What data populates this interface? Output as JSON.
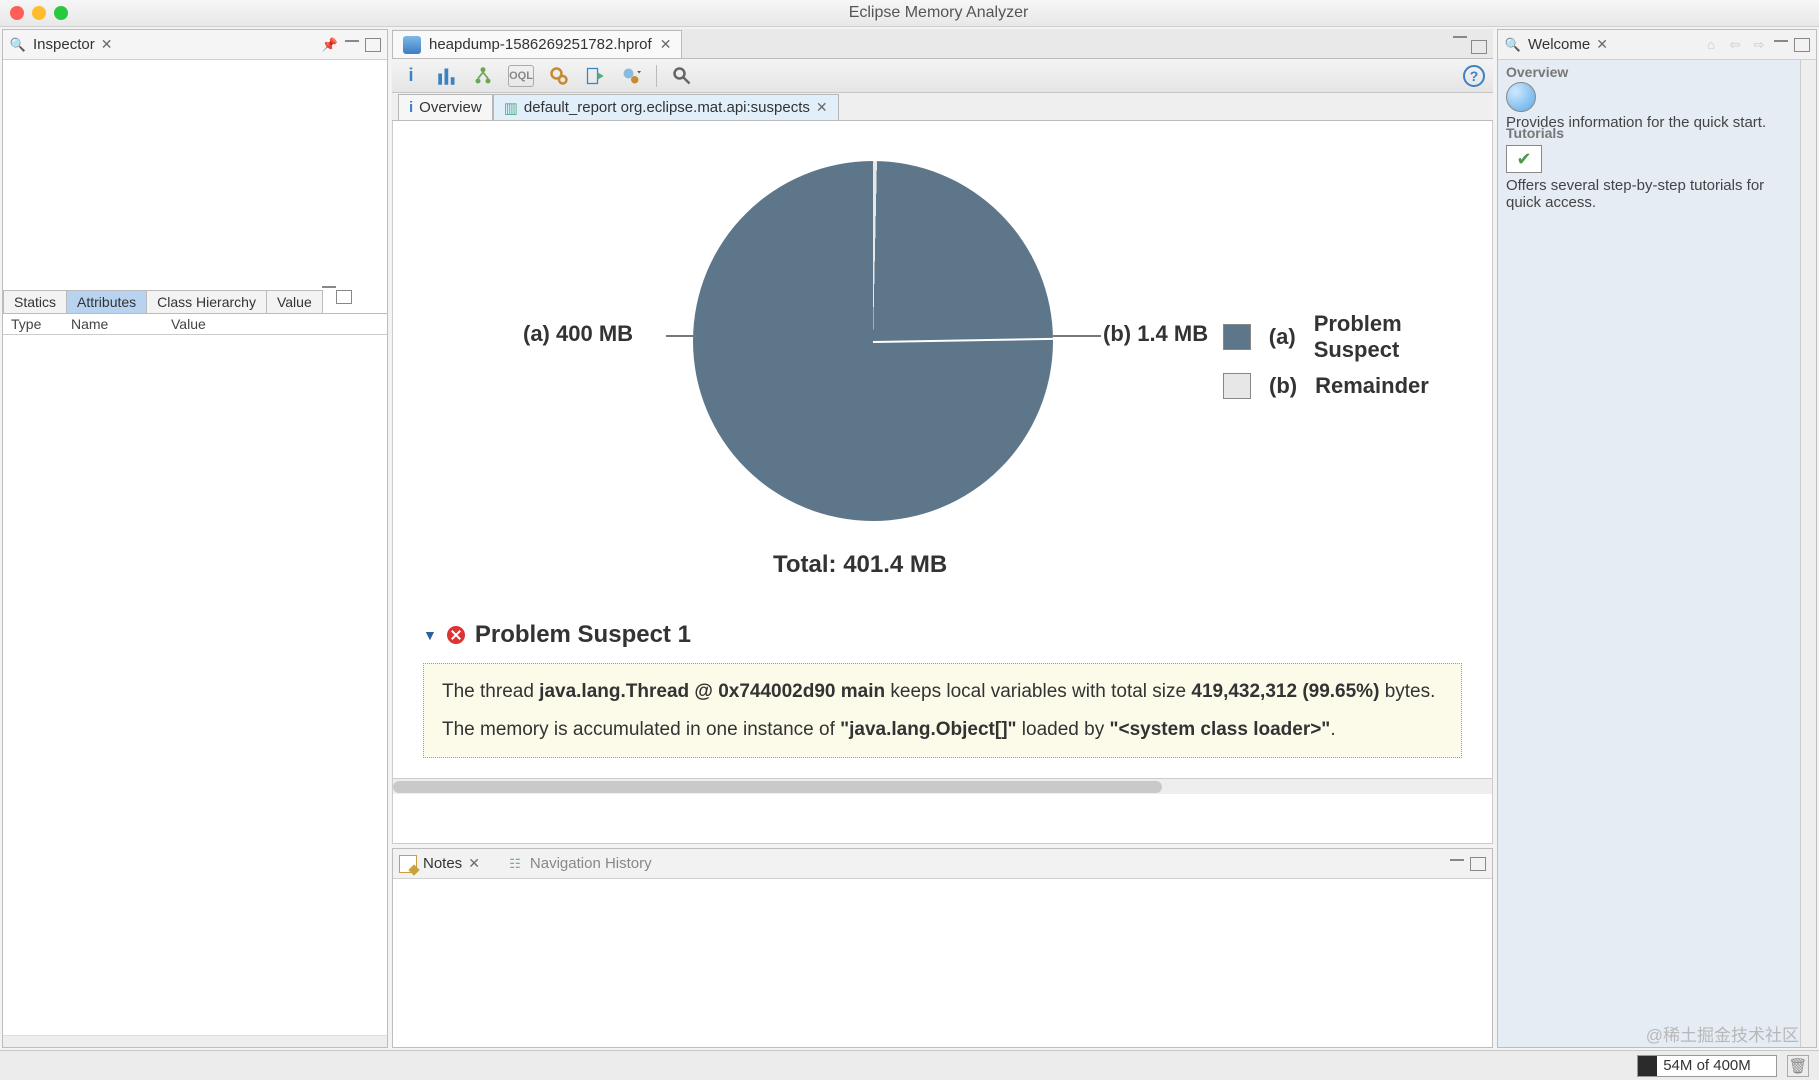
{
  "window": {
    "title": "Eclipse Memory Analyzer"
  },
  "inspector": {
    "title": "Inspector",
    "tabs": [
      "Statics",
      "Attributes",
      "Class Hierarchy",
      "Value"
    ],
    "active_tab": 1,
    "columns": [
      "Type",
      "Name",
      "Value"
    ]
  },
  "editor": {
    "tab_file": "heapdump-1586269251782.hprof",
    "sub_tabs": {
      "overview": "Overview",
      "report": "default_report  org.eclipse.mat.api:suspects"
    },
    "chart_data": {
      "type": "pie",
      "series": [
        {
          "name": "Problem Suspect",
          "label": "(a)",
          "value_mb": 400,
          "display": "400 MB",
          "color": "#5e768a"
        },
        {
          "name": "Remainder",
          "label": "(b)",
          "value_mb": 1.4,
          "display": "1.4 MB",
          "color": "#e7e7e7"
        }
      ],
      "total_mb": 401.4,
      "total_label": "Total: 401.4 MB",
      "legend": [
        {
          "key": "(a)",
          "text": "Problem Suspect"
        },
        {
          "key": "(b)",
          "text": "Remainder"
        }
      ],
      "inline_labels": {
        "a": "(a)  400 MB",
        "b": "(b)  1.4 MB"
      }
    },
    "suspect": {
      "heading": "Problem Suspect 1",
      "line1_pre": "The thread ",
      "line1_bold1": "java.lang.Thread @ 0x744002d90 main",
      "line1_mid": " keeps local variables with total size ",
      "line1_bold2": "419,432,312 (99.65%)",
      "line1_post": " bytes.",
      "line2_pre": "The memory is accumulated in one instance of ",
      "line2_bold1": "\"java.lang.Object[]\"",
      "line2_mid": " loaded by ",
      "line2_bold2": "\"<system class loader>\"",
      "line2_post": "."
    }
  },
  "notes": {
    "title": "Notes",
    "nav": "Navigation History"
  },
  "welcome": {
    "title": "Welcome",
    "sections": {
      "overview_title": "Overview",
      "overview_desc": "Provides information for the quick start.",
      "tutorials_title": "Tutorials",
      "tutorials_desc": "Offers several step-by-step tutorials for quick access."
    }
  },
  "status": {
    "heap": "54M of 400M"
  },
  "watermark": "@稀土掘金技术社区"
}
